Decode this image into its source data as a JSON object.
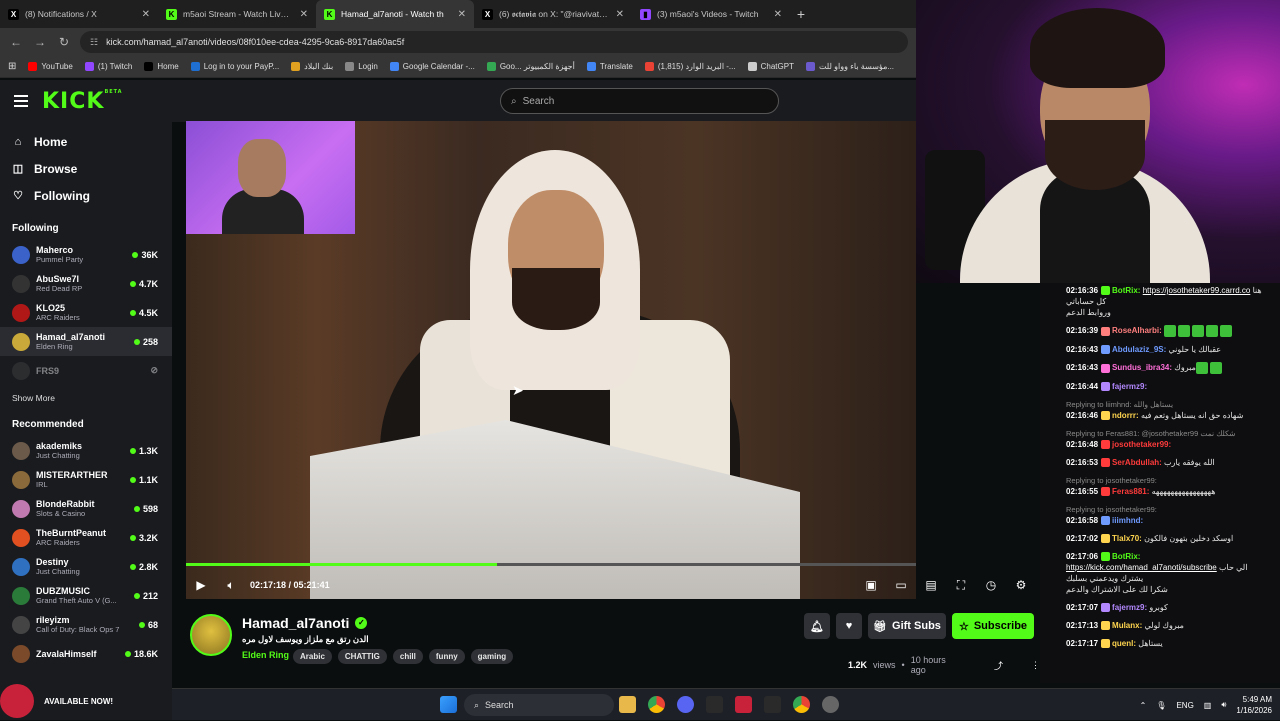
{
  "browser": {
    "tabs": [
      {
        "title": "(8) Notifications / X",
        "favicon": "x-icon",
        "color": "#000000"
      },
      {
        "title": "m5aoi Stream - Watch Live on Kick",
        "favicon": "kick-icon",
        "color": "#53fc18"
      },
      {
        "title": "Hamad_al7anoti - Watch th",
        "favicon": "kick-icon",
        "color": "#53fc18"
      },
      {
        "title": "(6) 𝖔𝖈𝖙𝖆𝖛𝖎𝖆 on X: \"@riavivatu @",
        "favicon": "x-icon",
        "color": "#000000"
      },
      {
        "title": "(3) m5aoi's Videos - Twitch",
        "favicon": "twitch-icon",
        "color": "#9146ff"
      }
    ],
    "active_tab": 2,
    "url": "kick.com/hamad_al7anoti/videos/08f010ee-cdea-4295-9ca6-8917da60ac5f",
    "bookmarks": [
      {
        "label": "YouTube",
        "color": "#ff0000"
      },
      {
        "label": "(1) Twitch",
        "color": "#9146ff"
      },
      {
        "label": "Home",
        "color": "#000000"
      },
      {
        "label": "Log in to your PayP...",
        "color": "#1f6fd1"
      },
      {
        "label": "بنك البلاد",
        "color": "#e0a020"
      },
      {
        "label": "Login",
        "color": "#888888"
      },
      {
        "label": "Google Calendar -...",
        "color": "#4285f4"
      },
      {
        "label": "Goo... أجهزة الكمبيوتر",
        "color": "#34a853"
      },
      {
        "label": "Translate",
        "color": "#4285f4"
      },
      {
        "label": "(1,815) البريد الوارد -...",
        "color": "#ea4335"
      },
      {
        "label": "ChatGPT",
        "color": "#cccccc"
      },
      {
        "label": "مؤسسة باء وواو للت...",
        "color": "#6a5acd"
      }
    ]
  },
  "kick": {
    "logo": "KICK",
    "beta": "BETA",
    "search_placeholder": "Search",
    "nav": [
      {
        "label": "Home",
        "icon": "home-icon"
      },
      {
        "label": "Browse",
        "icon": "browse-icon"
      },
      {
        "label": "Following",
        "icon": "heart-icon"
      }
    ],
    "following_header": "Following",
    "following": [
      {
        "name": "Maherco",
        "game": "Pummel Party",
        "viewers": "36K",
        "color": "#3a62c9"
      },
      {
        "name": "AbuSwe7l",
        "game": "Red Dead RP",
        "viewers": "4.7K",
        "color": "#333333"
      },
      {
        "name": "KLO25",
        "game": "ARC Raiders",
        "viewers": "4.5K",
        "color": "#b01818"
      },
      {
        "name": "Hamad_al7anoti",
        "game": "Elden Ring",
        "viewers": "258",
        "color": "#c9a93a"
      },
      {
        "name": "FRS9",
        "game": "",
        "viewers": "",
        "color": "#444444"
      }
    ],
    "show_more": "Show More",
    "recommended_header": "Recommended",
    "recommended": [
      {
        "name": "akademiks",
        "game": "Just Chatting",
        "viewers": "1.3K",
        "color": "#6b5a4a"
      },
      {
        "name": "MISTERARTHER",
        "game": "IRL",
        "viewers": "1.1K",
        "color": "#8a6a3a"
      },
      {
        "name": "BlondeRabbit",
        "game": "Slots & Casino",
        "viewers": "598",
        "color": "#c07ab0"
      },
      {
        "name": "TheBurntPeanut",
        "game": "ARC Raiders",
        "viewers": "3.2K",
        "color": "#e05020"
      },
      {
        "name": "Destiny",
        "game": "Just Chatting",
        "viewers": "2.8K",
        "color": "#3070c0"
      },
      {
        "name": "DUBZMUSIC",
        "game": "Grand Theft Auto V (G...",
        "viewers": "212",
        "color": "#2a7a3a"
      },
      {
        "name": "rileyizm",
        "game": "Call of Duty: Black Ops 7",
        "viewers": "68",
        "color": "#444444"
      },
      {
        "name": "ZavalaHimself",
        "game": "",
        "viewers": "18.6K",
        "color": "#7a4a2a"
      }
    ],
    "available_now": "AVAILABLE NOW!"
  },
  "player": {
    "time_current": "02:17:18",
    "time_total": "05:21:41",
    "progress_fraction": 0.4266
  },
  "channel": {
    "name": "Hamad_al7anoti",
    "title": "الدن رتق مع ملزاز ويوسف لاول مره",
    "game": "Elden Ring",
    "tags": [
      "Arabic",
      "CHATTIG",
      "chill",
      "funny",
      "gaming"
    ],
    "gift_label": "Gift Subs",
    "subscribe_label": "Subscribe",
    "views": "1.2K",
    "views_suffix": "views",
    "ago": "10 hours ago"
  },
  "chat": [
    {
      "ts": "02:16:36",
      "user": "BotRix:",
      "color": "#53fc18",
      "text": "هنا كل حساباتي",
      "link": "https://josothetaker99.carrd.co",
      "extra": "وروابط الدعم",
      "reply": ""
    },
    {
      "ts": "02:16:39",
      "user": "RoseAlharbi:",
      "color": "#ff7f7f",
      "text": "",
      "link": "",
      "extra": "",
      "reply": "",
      "emotes": 5
    },
    {
      "ts": "02:16:43",
      "user": "Abdulaziz_9S:",
      "color": "#6f9bff",
      "text": "عقبالك يا حلوني",
      "link": "",
      "extra": "",
      "reply": ""
    },
    {
      "ts": "02:16:43",
      "user": "Sundus_ibra34:",
      "color": "#ff6fd8",
      "text": "مبروك",
      "link": "",
      "extra": "",
      "reply": "",
      "emotes": 2
    },
    {
      "ts": "02:16:44",
      "user": "fajermz9:",
      "color": "#b388ff",
      "text": "",
      "link": "",
      "extra": "",
      "reply": ""
    },
    {
      "ts": "02:16:46",
      "user": "ndorrr:",
      "color": "#ffd54f",
      "text": "شهاده حق انه يستاهل وتعم فيه",
      "link": "",
      "extra": "",
      "reply": "Replying to liimhnd: يستاهل والله"
    },
    {
      "ts": "02:16:48",
      "user": "josothetaker99:",
      "color": "#ff3b3b",
      "text": "",
      "link": "",
      "extra": "",
      "reply": "Replying to Feras881: @josothetaker99 شكلك نمت"
    },
    {
      "ts": "02:16:53",
      "user": "SerAbdullah:",
      "color": "#ff3b3b",
      "text": "الله يوفقه يارب",
      "link": "",
      "extra": "",
      "reply": ""
    },
    {
      "ts": "02:16:55",
      "user": "Feras881:",
      "color": "#ff3b3b",
      "text": "ههههههههههههههههه",
      "link": "",
      "extra": "",
      "reply": "Replying to josothetaker99:"
    },
    {
      "ts": "02:16:58",
      "user": "iiimhnd:",
      "color": "#6f9bff",
      "text": "",
      "link": "",
      "extra": "",
      "reply": "Replying to josothetaker99:"
    },
    {
      "ts": "02:17:02",
      "user": "Tlalx70:",
      "color": "#ffd54f",
      "text": "اوسكد دخلين بتهون فالكون",
      "link": "",
      "extra": "",
      "reply": ""
    },
    {
      "ts": "02:17:06",
      "user": "BotRix:",
      "color": "#53fc18",
      "text": "الي حاب يشترك ويدعمني بسلبك",
      "link": "https://kick.com/hamad_al7anoti/subscribe",
      "extra": "شكرا لك على الاشتراك والدعم",
      "reply": ""
    },
    {
      "ts": "02:17:07",
      "user": "fajermz9:",
      "color": "#b388ff",
      "text": "كوبرو",
      "link": "",
      "extra": "",
      "reply": ""
    },
    {
      "ts": "02:17:13",
      "user": "Mulanx:",
      "color": "#ffd54f",
      "text": "مبروك لولي",
      "link": "",
      "extra": "",
      "reply": ""
    },
    {
      "ts": "02:17:17",
      "user": "quenl:",
      "color": "#ffd54f",
      "text": "يستاهل",
      "link": "",
      "extra": "",
      "reply": ""
    }
  ],
  "taskbar": {
    "search": "Search",
    "lang": "ENG",
    "time": "5:49 AM",
    "date": "1/16/2026"
  }
}
